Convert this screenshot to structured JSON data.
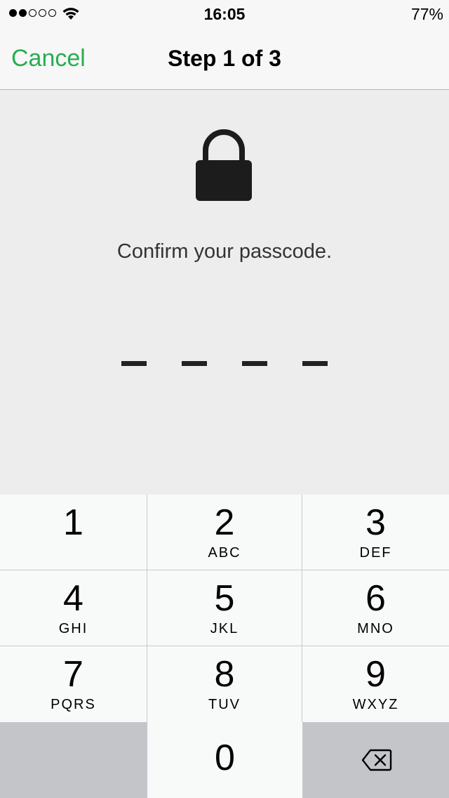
{
  "status_bar": {
    "signal_bars_filled": 2,
    "signal_bars_total": 5,
    "wifi_icon": "wifi-icon",
    "time": "16:05",
    "battery": "77%"
  },
  "nav": {
    "cancel_label": "Cancel",
    "title": "Step 1 of 3"
  },
  "content": {
    "lock_icon": "lock-icon",
    "prompt": "Confirm your passcode.",
    "passcode_length": 4,
    "entered_digits": 0
  },
  "keypad": {
    "keys": [
      {
        "digit": "1",
        "letters": ""
      },
      {
        "digit": "2",
        "letters": "ABC"
      },
      {
        "digit": "3",
        "letters": "DEF"
      },
      {
        "digit": "4",
        "letters": "GHI"
      },
      {
        "digit": "5",
        "letters": "JKL"
      },
      {
        "digit": "6",
        "letters": "MNO"
      },
      {
        "digit": "7",
        "letters": "PQRS"
      },
      {
        "digit": "8",
        "letters": "TUV"
      },
      {
        "digit": "9",
        "letters": "WXYZ"
      },
      {
        "digit": "0",
        "letters": ""
      }
    ],
    "delete_icon": "backspace-icon"
  },
  "colors": {
    "accent": "#27ae4f",
    "background": "#ededed",
    "key_background": "#f8faf9",
    "key_disabled": "#c3c5c8"
  }
}
